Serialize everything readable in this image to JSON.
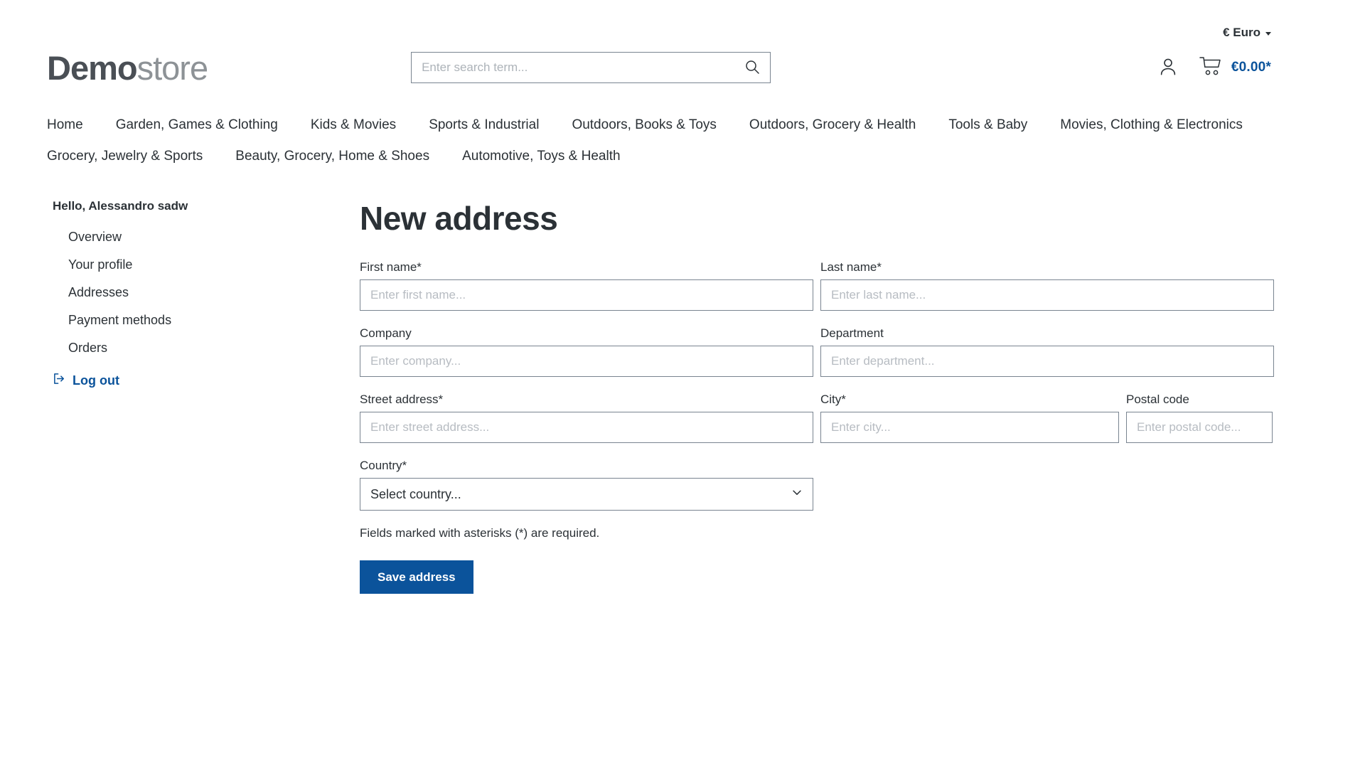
{
  "topbar": {
    "currency": "€ Euro",
    "currency_icon": "chevron-down-icon"
  },
  "header": {
    "logo_bold": "Demo",
    "logo_light": "store",
    "search": {
      "placeholder": "Enter search term...",
      "value": "",
      "icon": "search-icon"
    },
    "account_icon": "user-icon",
    "cart_icon": "shopping-cart-icon",
    "cart_amount": "€0.00*"
  },
  "navigation": {
    "items": [
      {
        "label": "Home"
      },
      {
        "label": "Garden, Games & Clothing"
      },
      {
        "label": "Kids & Movies"
      },
      {
        "label": "Sports & Industrial"
      },
      {
        "label": "Outdoors, Books & Toys"
      },
      {
        "label": "Outdoors, Grocery & Health"
      },
      {
        "label": "Tools & Baby"
      },
      {
        "label": "Movies, Clothing & Electronics"
      },
      {
        "label": "Grocery, Jewelry & Sports"
      },
      {
        "label": "Beauty, Grocery, Home & Shoes"
      },
      {
        "label": "Automotive, Toys & Health"
      }
    ]
  },
  "sidebar": {
    "greeting": "Hello, Alessandro sadw",
    "items": [
      {
        "label": "Overview"
      },
      {
        "label": "Your profile"
      },
      {
        "label": "Addresses"
      },
      {
        "label": "Payment methods"
      },
      {
        "label": "Orders"
      }
    ],
    "logout": {
      "label": "Log out",
      "icon": "logout-icon"
    }
  },
  "main": {
    "title": "New address",
    "fields": {
      "first_name": {
        "label": "First name*",
        "placeholder": "Enter first name...",
        "value": ""
      },
      "last_name": {
        "label": "Last name*",
        "placeholder": "Enter last name...",
        "value": ""
      },
      "company": {
        "label": "Company",
        "placeholder": "Enter company...",
        "value": ""
      },
      "department": {
        "label": "Department",
        "placeholder": "Enter department...",
        "value": ""
      },
      "street": {
        "label": "Street address*",
        "placeholder": "Enter street address...",
        "value": ""
      },
      "city": {
        "label": "City*",
        "placeholder": "Enter city...",
        "value": ""
      },
      "postal": {
        "label": "Postal code",
        "placeholder": "Enter postal code...",
        "value": ""
      },
      "country": {
        "label": "Country*",
        "selected": "Select country...",
        "icon": "chevron-down-icon"
      }
    },
    "required_hint": "Fields marked with asterisks (*) are required.",
    "save_button": "Save address"
  },
  "colors": {
    "accent_blue": "#0b539b",
    "text": "#2b3136",
    "border": "#798490",
    "placeholder": "#b7bcc2",
    "logo_bold": "#4a4f55",
    "logo_light": "#8d9296"
  }
}
